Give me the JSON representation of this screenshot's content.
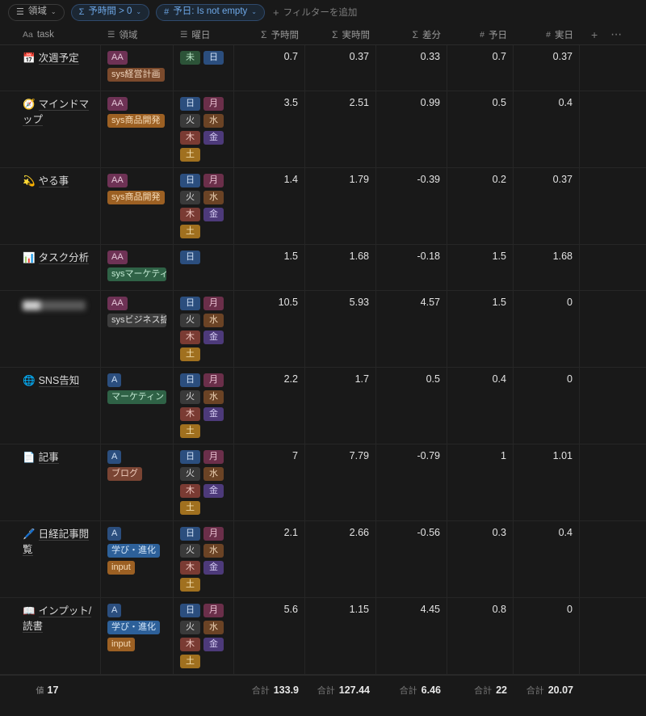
{
  "filter_bar": {
    "filters": [
      {
        "icon": "list-icon",
        "glyph": "☰",
        "label": "領域",
        "caret": "⌄",
        "state": "inactive"
      },
      {
        "icon": "sigma-icon",
        "glyph": "Σ",
        "label": "予時間 > 0",
        "caret": "⌄",
        "state": "active"
      },
      {
        "icon": "hash-icon",
        "glyph": "#",
        "label": "予日: Is not empty",
        "caret": "⌄",
        "state": "active"
      }
    ],
    "add_filter": {
      "icon": "plus-icon",
      "glyph": "+",
      "label": "フィルターを追加"
    }
  },
  "table": {
    "columns": [
      {
        "icon": "title-icon",
        "glyph": "Aa",
        "label": "task"
      },
      {
        "icon": "list-icon",
        "glyph": "☰",
        "label": "領域"
      },
      {
        "icon": "list-icon",
        "glyph": "☰",
        "label": "曜日"
      },
      {
        "icon": "sigma-icon",
        "glyph": "Σ",
        "label": "予時間"
      },
      {
        "icon": "sigma-icon",
        "glyph": "Σ",
        "label": "実時間"
      },
      {
        "icon": "sigma-icon",
        "glyph": "Σ",
        "label": "差分"
      },
      {
        "icon": "hash-icon",
        "glyph": "#",
        "label": "予日"
      },
      {
        "icon": "hash-icon",
        "glyph": "#",
        "label": "実日"
      }
    ],
    "header_actions": [
      {
        "icon": "add-column-icon",
        "glyph": "+"
      },
      {
        "icon": "more-options-icon",
        "glyph": "⋯"
      }
    ],
    "rows": [
      {
        "emoji": "📅",
        "task": "次週予定",
        "blurred": false,
        "area": [
          {
            "label": "AA",
            "color": "#6e3255",
            "text": "#e6c8d9"
          },
          {
            "label": "sys経営計画",
            "color": "#7b4a2c",
            "text": "#f0d5bd"
          }
        ],
        "days": [
          {
            "label": "未",
            "color": "#2c5338",
            "text": "#b9e4c6"
          },
          {
            "label": "日",
            "color": "#2b4e7e",
            "text": "#cfe0f5"
          }
        ],
        "yotei_jikan": "0.7",
        "jitsu_jikan": "0.37",
        "sabun": "0.33",
        "yojitsu": "0.7",
        "jitsujitsu": "0.37"
      },
      {
        "emoji": "🧭",
        "task": "マインドマップ",
        "blurred": false,
        "area": [
          {
            "label": "AA",
            "color": "#6e3255",
            "text": "#e6c8d9"
          },
          {
            "label": "sys商品開発",
            "color": "#9c6023",
            "text": "#f6dcb9"
          }
        ],
        "days": [
          {
            "label": "日",
            "color": "#2b4e7e",
            "text": "#cfe0f5"
          },
          {
            "label": "月",
            "color": "#6b2f4a",
            "text": "#ecc4d5"
          },
          {
            "label": "火",
            "color": "#3a3a3a",
            "text": "#d6d6d6"
          },
          {
            "label": "水",
            "color": "#6b4325",
            "text": "#eed3b5"
          },
          {
            "label": "木",
            "color": "#7a3b33",
            "text": "#f0c9c2"
          },
          {
            "label": "金",
            "color": "#4d3a7a",
            "text": "#d3c9f0"
          },
          {
            "label": "土",
            "color": "#a0701f",
            "text": "#f7e3b6"
          }
        ],
        "yotei_jikan": "3.5",
        "jitsu_jikan": "2.51",
        "sabun": "0.99",
        "yojitsu": "0.5",
        "jitsujitsu": "0.4"
      },
      {
        "emoji": "💫",
        "task": "やる事",
        "blurred": false,
        "area": [
          {
            "label": "AA",
            "color": "#6e3255",
            "text": "#e6c8d9"
          },
          {
            "label": "sys商品開発",
            "color": "#9c6023",
            "text": "#f6dcb9"
          }
        ],
        "days": [
          {
            "label": "日",
            "color": "#2b4e7e",
            "text": "#cfe0f5"
          },
          {
            "label": "月",
            "color": "#6b2f4a",
            "text": "#ecc4d5"
          },
          {
            "label": "火",
            "color": "#3a3a3a",
            "text": "#d6d6d6"
          },
          {
            "label": "水",
            "color": "#6b4325",
            "text": "#eed3b5"
          },
          {
            "label": "木",
            "color": "#7a3b33",
            "text": "#f0c9c2"
          },
          {
            "label": "金",
            "color": "#4d3a7a",
            "text": "#d3c9f0"
          },
          {
            "label": "土",
            "color": "#a0701f",
            "text": "#f7e3b6"
          }
        ],
        "yotei_jikan": "1.4",
        "jitsu_jikan": "1.79",
        "sabun": "-0.39",
        "yojitsu": "0.2",
        "jitsujitsu": "0.37"
      },
      {
        "emoji": "📊",
        "task": "タスク分析",
        "blurred": false,
        "area": [
          {
            "label": "AA",
            "color": "#6e3255",
            "text": "#e6c8d9"
          },
          {
            "label": "sysマーケティ",
            "color": "#2f6246",
            "text": "#c2e8d2"
          }
        ],
        "days": [
          {
            "label": "日",
            "color": "#2b4e7e",
            "text": "#cfe0f5"
          }
        ],
        "yotei_jikan": "1.5",
        "jitsu_jikan": "1.68",
        "sabun": "-0.18",
        "yojitsu": "1.5",
        "jitsujitsu": "1.68"
      },
      {
        "emoji": "",
        "task": "",
        "blurred": true,
        "area": [
          {
            "label": "AA",
            "color": "#6e3255",
            "text": "#e6c8d9"
          },
          {
            "label": "sysビジネス拡",
            "color": "#3d3d3d",
            "text": "#dcdcdc"
          }
        ],
        "days": [
          {
            "label": "日",
            "color": "#2b4e7e",
            "text": "#cfe0f5"
          },
          {
            "label": "月",
            "color": "#6b2f4a",
            "text": "#ecc4d5"
          },
          {
            "label": "火",
            "color": "#3a3a3a",
            "text": "#d6d6d6"
          },
          {
            "label": "水",
            "color": "#6b4325",
            "text": "#eed3b5"
          },
          {
            "label": "木",
            "color": "#7a3b33",
            "text": "#f0c9c2"
          },
          {
            "label": "金",
            "color": "#4d3a7a",
            "text": "#d3c9f0"
          },
          {
            "label": "土",
            "color": "#a0701f",
            "text": "#f7e3b6"
          }
        ],
        "yotei_jikan": "10.5",
        "jitsu_jikan": "5.93",
        "sabun": "4.57",
        "yojitsu": "1.5",
        "jitsujitsu": "0"
      },
      {
        "emoji": "🌐",
        "task": "SNS告知",
        "blurred": false,
        "area": [
          {
            "label": "A",
            "color": "#2b4e7e",
            "text": "#cfe0f5"
          },
          {
            "label": "マーケティン",
            "color": "#2f6246",
            "text": "#c2e8d2"
          }
        ],
        "days": [
          {
            "label": "日",
            "color": "#2b4e7e",
            "text": "#cfe0f5"
          },
          {
            "label": "月",
            "color": "#6b2f4a",
            "text": "#ecc4d5"
          },
          {
            "label": "火",
            "color": "#3a3a3a",
            "text": "#d6d6d6"
          },
          {
            "label": "水",
            "color": "#6b4325",
            "text": "#eed3b5"
          },
          {
            "label": "木",
            "color": "#7a3b33",
            "text": "#f0c9c2"
          },
          {
            "label": "金",
            "color": "#4d3a7a",
            "text": "#d3c9f0"
          },
          {
            "label": "土",
            "color": "#a0701f",
            "text": "#f7e3b6"
          }
        ],
        "yotei_jikan": "2.2",
        "jitsu_jikan": "1.7",
        "sabun": "0.5",
        "yojitsu": "0.4",
        "jitsujitsu": "0"
      },
      {
        "emoji": "📄",
        "task": "記事",
        "blurred": false,
        "area": [
          {
            "label": "A",
            "color": "#2b4e7e",
            "text": "#cfe0f5"
          },
          {
            "label": "ブログ",
            "color": "#7a4433",
            "text": "#f0cdbd"
          }
        ],
        "days": [
          {
            "label": "日",
            "color": "#2b4e7e",
            "text": "#cfe0f5"
          },
          {
            "label": "月",
            "color": "#6b2f4a",
            "text": "#ecc4d5"
          },
          {
            "label": "火",
            "color": "#3a3a3a",
            "text": "#d6d6d6"
          },
          {
            "label": "水",
            "color": "#6b4325",
            "text": "#eed3b5"
          },
          {
            "label": "木",
            "color": "#7a3b33",
            "text": "#f0c9c2"
          },
          {
            "label": "金",
            "color": "#4d3a7a",
            "text": "#d3c9f0"
          },
          {
            "label": "土",
            "color": "#a0701f",
            "text": "#f7e3b6"
          }
        ],
        "yotei_jikan": "7",
        "jitsu_jikan": "7.79",
        "sabun": "-0.79",
        "yojitsu": "1",
        "jitsujitsu": "1.01"
      },
      {
        "emoji": "🖊️",
        "task": "日経記事閲覧",
        "blurred": false,
        "area": [
          {
            "label": "A",
            "color": "#2b4e7e",
            "text": "#cfe0f5"
          },
          {
            "label": "学び・進化",
            "color": "#2d6099",
            "text": "#d2e5f8"
          },
          {
            "label": "input",
            "color": "#9c6023",
            "text": "#f6dcb9"
          }
        ],
        "days": [
          {
            "label": "日",
            "color": "#2b4e7e",
            "text": "#cfe0f5"
          },
          {
            "label": "月",
            "color": "#6b2f4a",
            "text": "#ecc4d5"
          },
          {
            "label": "火",
            "color": "#3a3a3a",
            "text": "#d6d6d6"
          },
          {
            "label": "水",
            "color": "#6b4325",
            "text": "#eed3b5"
          },
          {
            "label": "木",
            "color": "#7a3b33",
            "text": "#f0c9c2"
          },
          {
            "label": "金",
            "color": "#4d3a7a",
            "text": "#d3c9f0"
          },
          {
            "label": "土",
            "color": "#a0701f",
            "text": "#f7e3b6"
          }
        ],
        "yotei_jikan": "2.1",
        "jitsu_jikan": "2.66",
        "sabun": "-0.56",
        "yojitsu": "0.3",
        "jitsujitsu": "0.4"
      },
      {
        "emoji": "📖",
        "task": "インプット/読書",
        "blurred": false,
        "area": [
          {
            "label": "A",
            "color": "#2b4e7e",
            "text": "#cfe0f5"
          },
          {
            "label": "学び・進化",
            "color": "#2d6099",
            "text": "#d2e5f8"
          },
          {
            "label": "input",
            "color": "#9c6023",
            "text": "#f6dcb9"
          }
        ],
        "days": [
          {
            "label": "日",
            "color": "#2b4e7e",
            "text": "#cfe0f5"
          },
          {
            "label": "月",
            "color": "#6b2f4a",
            "text": "#ecc4d5"
          },
          {
            "label": "火",
            "color": "#3a3a3a",
            "text": "#d6d6d6"
          },
          {
            "label": "水",
            "color": "#6b4325",
            "text": "#eed3b5"
          },
          {
            "label": "木",
            "color": "#7a3b33",
            "text": "#f0c9c2"
          },
          {
            "label": "金",
            "color": "#4d3a7a",
            "text": "#d3c9f0"
          },
          {
            "label": "土",
            "color": "#a0701f",
            "text": "#f7e3b6"
          }
        ],
        "yotei_jikan": "5.6",
        "jitsu_jikan": "1.15",
        "sabun": "4.45",
        "yojitsu": "0.8",
        "jitsujitsu": "0"
      }
    ],
    "footer": {
      "count_icon": "count-icon",
      "count_label": "値",
      "count_value": "17",
      "totals": [
        {
          "label": "合計",
          "value": "133.9"
        },
        {
          "label": "合計",
          "value": "127.44"
        },
        {
          "label": "合計",
          "value": "6.46"
        },
        {
          "label": "合計",
          "value": "22"
        },
        {
          "label": "合計",
          "value": "20.07"
        }
      ]
    }
  },
  "colors": {
    "background": "#191919",
    "border": "#262626",
    "text": "#d4d4d4",
    "muted": "#8a8a8a",
    "accent": "#6ea8e8"
  }
}
